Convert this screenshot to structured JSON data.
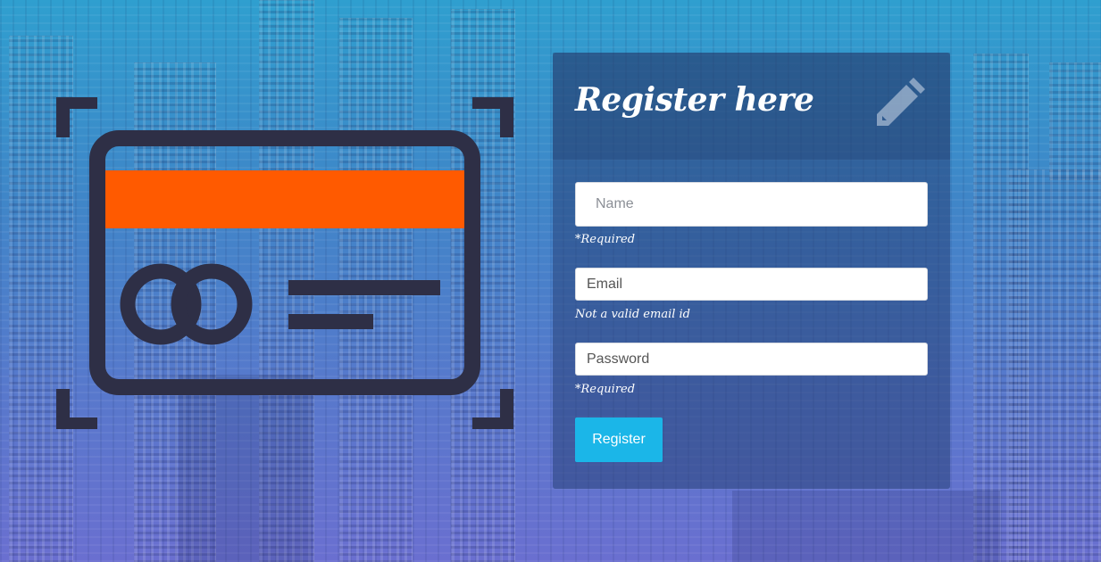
{
  "form": {
    "title": "Register here",
    "name_placeholder": "Name",
    "name_hint": "*Required",
    "email_placeholder": "Email",
    "email_hint": "Not a valid email id",
    "password_placeholder": "Password",
    "password_hint": "*Required",
    "submit_label": "Register",
    "header_icon": "pencil-icon"
  },
  "illustration": {
    "icon": "credit-card-icon",
    "colors": {
      "outline": "#2e2f46",
      "stripe": "#ff5a00"
    }
  },
  "colors": {
    "accent_button": "#1bb6e8",
    "background_top": "#2f9fcf",
    "background_bottom": "#6a6fd0"
  }
}
